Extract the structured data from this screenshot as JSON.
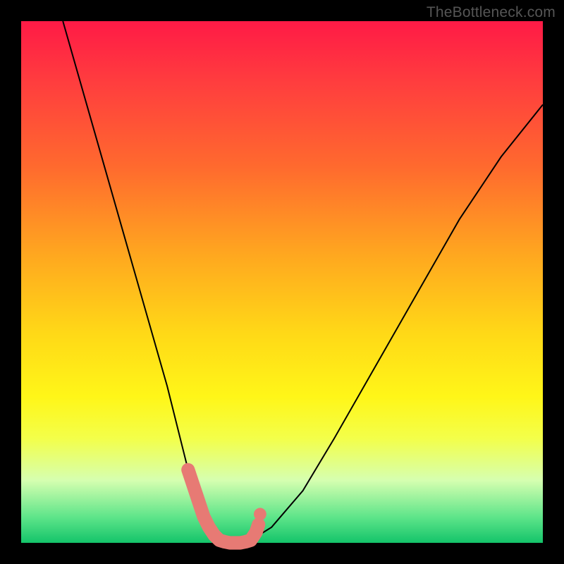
{
  "watermark": "TheBottleneck.com",
  "chart_data": {
    "type": "line",
    "title": "",
    "xlabel": "",
    "ylabel": "",
    "xlim": [
      0,
      100
    ],
    "ylim": [
      0,
      100
    ],
    "background_gradient": {
      "orientation": "vertical",
      "stops": [
        {
          "pct": 0,
          "color": "#ff1a46"
        },
        {
          "pct": 12,
          "color": "#ff3e3e"
        },
        {
          "pct": 28,
          "color": "#ff6a2e"
        },
        {
          "pct": 45,
          "color": "#ffa81f"
        },
        {
          "pct": 60,
          "color": "#ffd917"
        },
        {
          "pct": 72,
          "color": "#fff618"
        },
        {
          "pct": 80,
          "color": "#f3ff4a"
        },
        {
          "pct": 88,
          "color": "#d6ffb0"
        },
        {
          "pct": 95,
          "color": "#5fe58a"
        },
        {
          "pct": 100,
          "color": "#14c46a"
        }
      ]
    },
    "series": [
      {
        "name": "bottleneck-curve",
        "color": "#000000",
        "width": 2,
        "x": [
          8,
          12,
          16,
          20,
          24,
          28,
          30,
          32,
          34,
          36,
          38,
          40,
          42,
          44,
          48,
          54,
          60,
          68,
          76,
          84,
          92,
          100
        ],
        "y": [
          100,
          86,
          72,
          58,
          44,
          30,
          22,
          14,
          8,
          3,
          0.5,
          0,
          0,
          0.5,
          3,
          10,
          20,
          34,
          48,
          62,
          74,
          84
        ]
      }
    ],
    "highlight": {
      "name": "trough-highlight",
      "color": "#e77a74",
      "dot_radius": 1.2,
      "stroke_width": 2.6,
      "x": [
        32,
        33,
        34,
        35,
        36,
        37,
        38,
        39,
        40,
        41,
        42,
        43,
        44,
        45,
        45.5
      ],
      "y": [
        14,
        11,
        8,
        5,
        3,
        1.5,
        0.5,
        0.2,
        0,
        0,
        0,
        0.2,
        0.5,
        2,
        3.5
      ]
    }
  }
}
